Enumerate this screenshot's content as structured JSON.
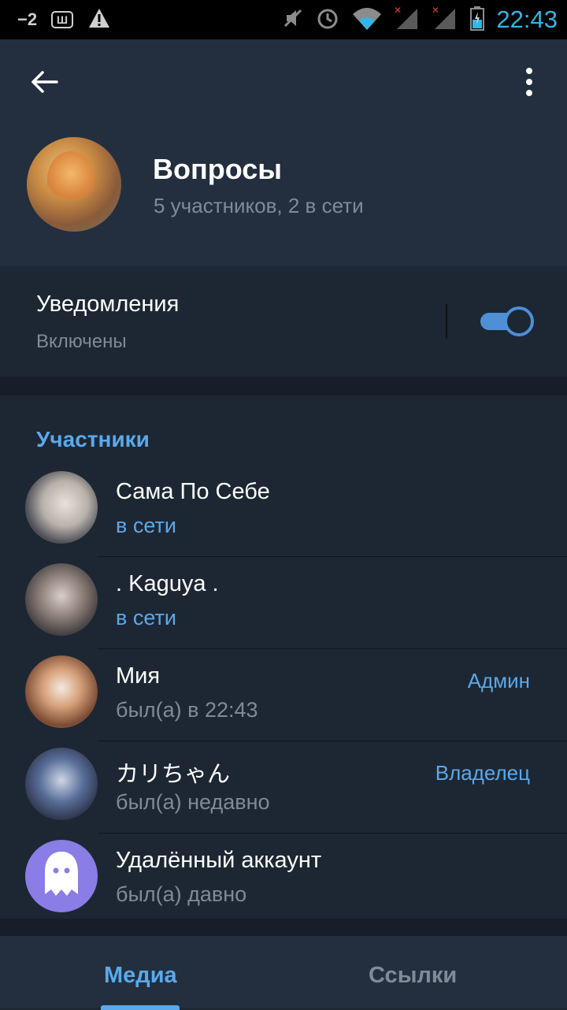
{
  "statusbar": {
    "signal_text": "−2",
    "app_icon_text": "Ш",
    "time": "22:43"
  },
  "header": {
    "title": "Вопросы",
    "subtitle": "5 участников, 2 в сети"
  },
  "notifications": {
    "title": "Уведомления",
    "status": "Включены",
    "enabled": true
  },
  "members": {
    "section_title": "Участники",
    "items": [
      {
        "name": "Сама По Себе",
        "status": "в сети",
        "online": true,
        "role": ""
      },
      {
        "name": ". Kaguya .",
        "status": "в сети",
        "online": true,
        "role": ""
      },
      {
        "name": "Мия",
        "status": "был(а) в 22:43",
        "online": false,
        "role": "Админ"
      },
      {
        "name": "カリちゃん",
        "status": "был(а) недавно",
        "online": false,
        "role": "Владелец"
      },
      {
        "name": "Удалённый аккаунт",
        "status": "был(а) давно",
        "online": false,
        "role": ""
      }
    ]
  },
  "tabs": {
    "media": "Медиа",
    "links": "Ссылки"
  },
  "colors": {
    "accent": "#5aa9ec",
    "background": "#1d2733",
    "header": "#232f3e"
  }
}
